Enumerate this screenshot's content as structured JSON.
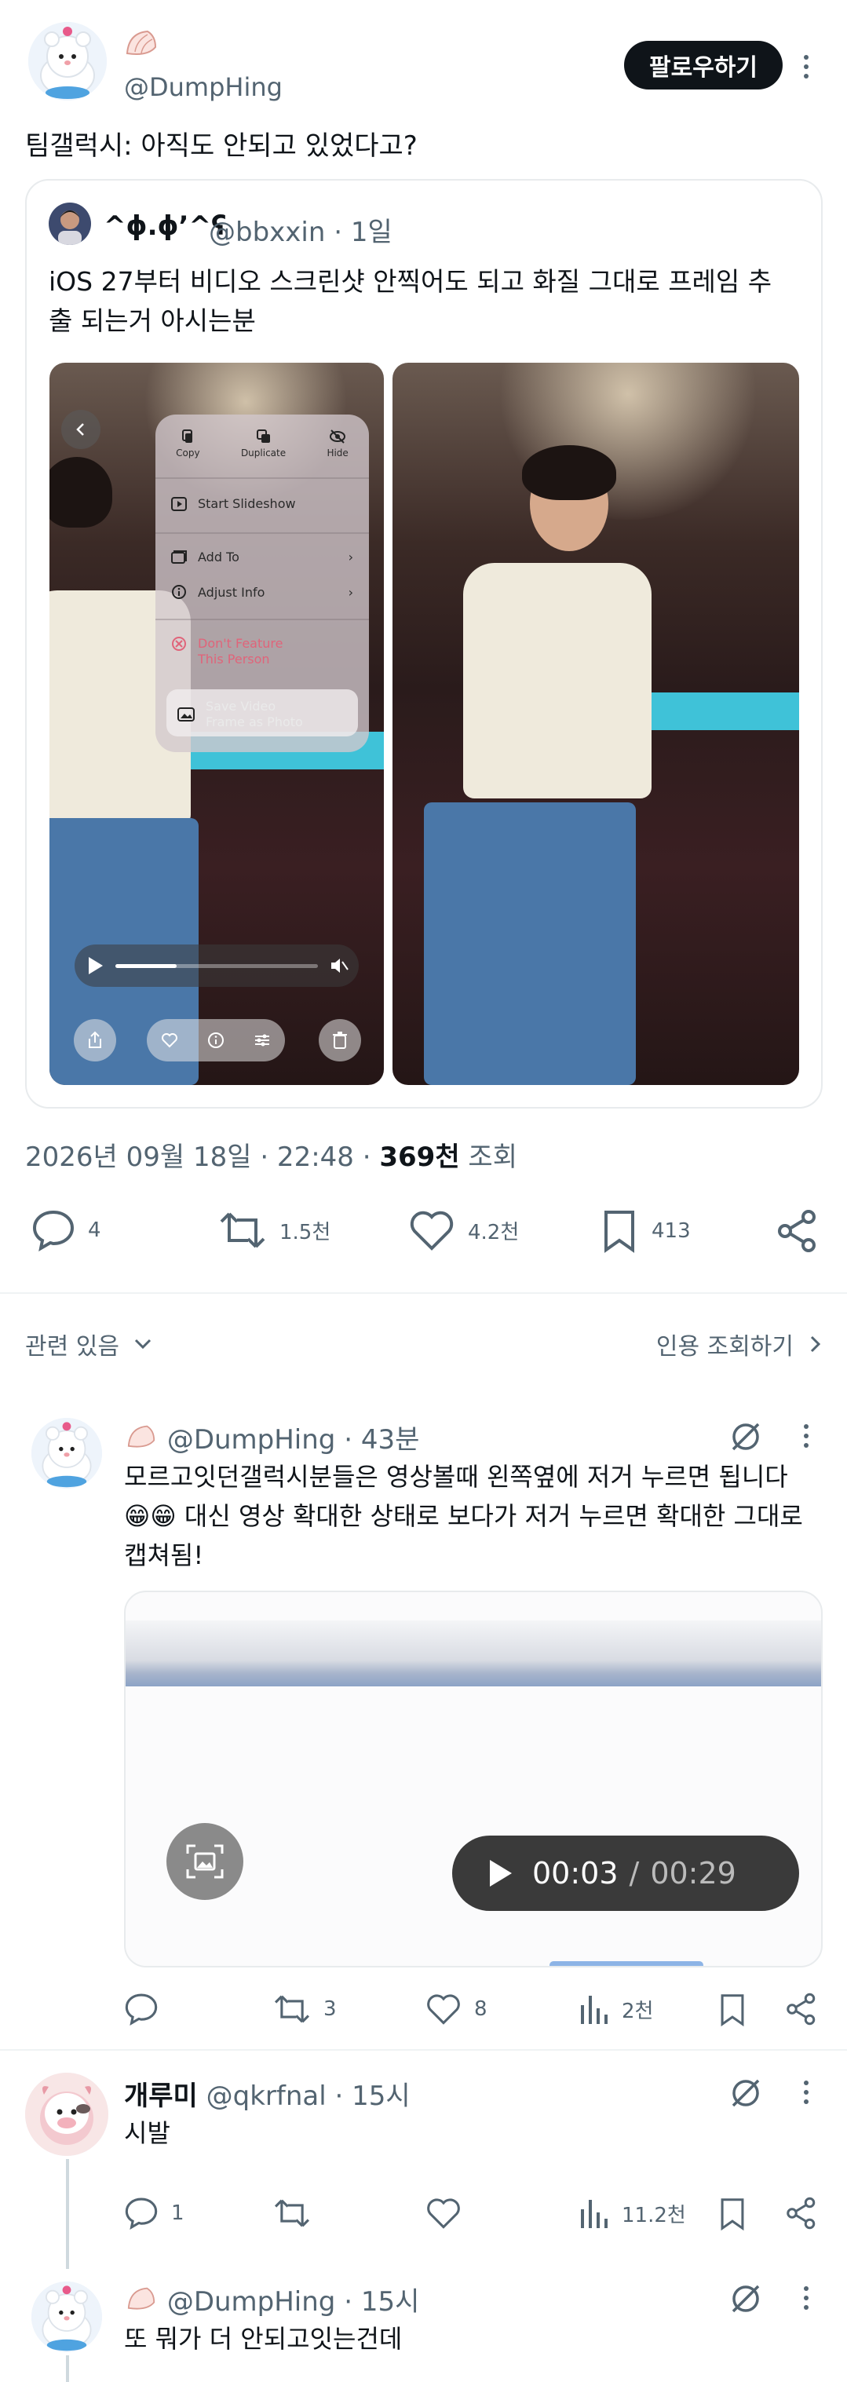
{
  "main_tweet": {
    "avatar_icon": "bear-mascot-avatar-icon",
    "badge_icon": "clam-shell-icon",
    "handle": "@DumpHing",
    "follow_label": "팔로우하기",
    "text": "팀갤럭시: 아직도 안되고 있었다고?"
  },
  "quote": {
    "name": "^ɸ.ɸʼ^ʕ",
    "handle": "@bbxxin · 1일",
    "text": "iOS 27부터 비디오 스크린샷 안찍어도 되고 화질 그대로 프레임 추출 되는거 아시는분",
    "menu": {
      "copy": "Copy",
      "duplicate": "Duplicate",
      "hide": "Hide",
      "start_slideshow": "Start Slideshow",
      "add_to": "Add To",
      "adjust_info": "Adjust Info",
      "dont_feature": "Don't Feature This Person",
      "save_video_frame": "Save Video Frame as Photo"
    },
    "banner_color": "#3fc2d8"
  },
  "meta": {
    "date": "2026년 09월 18일 · 22:48 · ",
    "views_count": "369천",
    "views_label": " 조회"
  },
  "actions": {
    "replies": "4",
    "retweets": "1.5천",
    "likes": "4.2천",
    "bookmarks": "413"
  },
  "related": {
    "label": "관련 있음",
    "quote_views": "인용 조회하기"
  },
  "replies": [
    {
      "name": "@DumpHing",
      "time": " · 43분",
      "text": "모르고잇던갤럭시분들은 영상볼때 왼쪽옆에 저거 누르면 됩니다😁😁 대신 영상 확대한 상태로 보다가 저거 누르면 확대한 그대로 캡쳐됨!",
      "video": {
        "current": "00:03",
        "separator": "/",
        "duration": "00:29"
      },
      "stats": {
        "retweets": "3",
        "likes": "8",
        "views": "2천"
      }
    },
    {
      "name": "개루미",
      "handle": "@qkrfnal",
      "time": " · 15시",
      "text": "시발",
      "stats": {
        "replies": "1",
        "views": "11.2천"
      }
    },
    {
      "name": "@DumpHing",
      "time": " · 15시",
      "text": "또 뭐가 더 안되고잇는건데"
    }
  ],
  "colors": {
    "text": "#0f1419",
    "muted": "#536471",
    "border": "#e8ebed",
    "follow_bg": "#0f1419"
  }
}
